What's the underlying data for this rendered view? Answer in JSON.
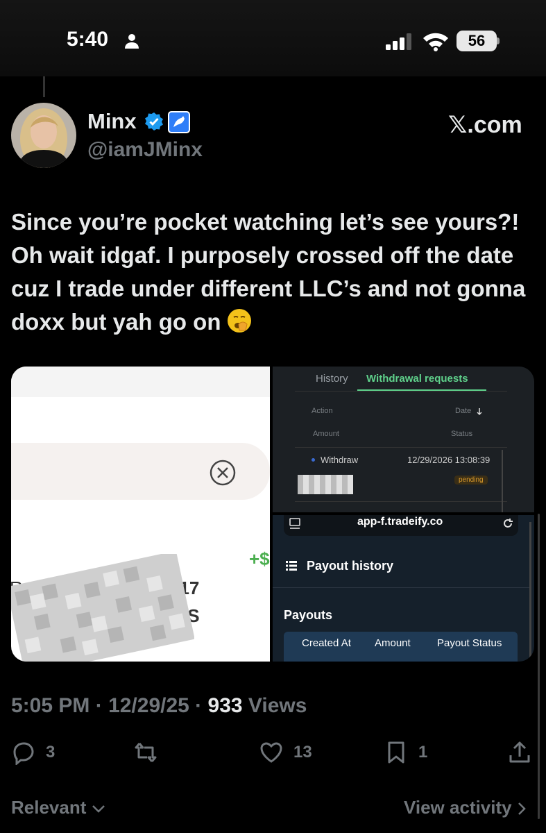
{
  "status": {
    "time": "5:40",
    "battery": "56"
  },
  "author": {
    "name": "Minx",
    "handle": "@iamJMinx",
    "source": "𝕏.com"
  },
  "tweet": {
    "text": "Since you’re pocket watching let’s see yours?! Oh wait idgaf.  I purposely crossed off the date cuz I trade under different LLC’s and not gonna doxx but yah go on"
  },
  "media1": {
    "plus": "+$",
    "line1_left": "R 855",
    "line1_right": "217",
    "line2_right": "GS"
  },
  "media2": {
    "tab_history": "History",
    "tab_withdrawals": "Withdrawal requests",
    "col_action": "Action",
    "col_date": "Date",
    "col_amount": "Amount",
    "col_status": "Status",
    "row_action": "Withdraw",
    "row_date": "12/29/2026 13:08:39",
    "row_status": "pending"
  },
  "media3": {
    "url": "app-f.tradeify.co",
    "section": "Payout history",
    "heading": "Payouts",
    "headers": [
      "Created At",
      "Amount",
      "Payout Status"
    ]
  },
  "meta": {
    "time": "5:05 PM",
    "date": "12/29/25",
    "views_count": "933",
    "views_label": "Views"
  },
  "actions": {
    "replies": "3",
    "reposts": "",
    "likes": "13",
    "bookmarks": "1"
  },
  "footer": {
    "sort": "Relevant",
    "activity": "View activity"
  }
}
